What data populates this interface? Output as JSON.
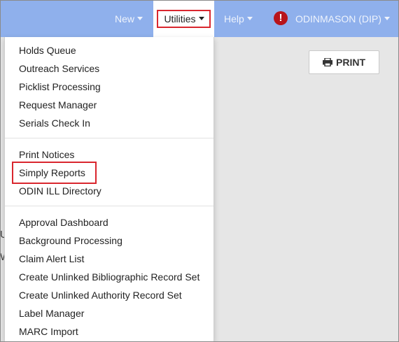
{
  "navbar": {
    "new_label": "New",
    "utilities_label": "Utilities",
    "help_label": "Help",
    "user_label": "ODINMASON (DIP)",
    "alert_glyph": "!"
  },
  "toolbar": {
    "print_label": "PRINT"
  },
  "background": {
    "line1": "U",
    "line2": "W"
  },
  "menu": {
    "group1": [
      "Holds Queue",
      "Outreach Services",
      "Picklist Processing",
      "Request Manager",
      "Serials Check In"
    ],
    "group2": [
      "Print Notices",
      "Simply Reports",
      "ODIN ILL Directory"
    ],
    "group3": [
      "Approval Dashboard",
      "Background Processing",
      "Claim Alert List",
      "Create Unlinked Bibliographic Record Set",
      "Create Unlinked Authority Record Set",
      "Label Manager",
      "MARC Import"
    ]
  },
  "colors": {
    "navbar": "#8fb0ec",
    "highlight": "#d9262e",
    "alert": "#b8141b"
  }
}
